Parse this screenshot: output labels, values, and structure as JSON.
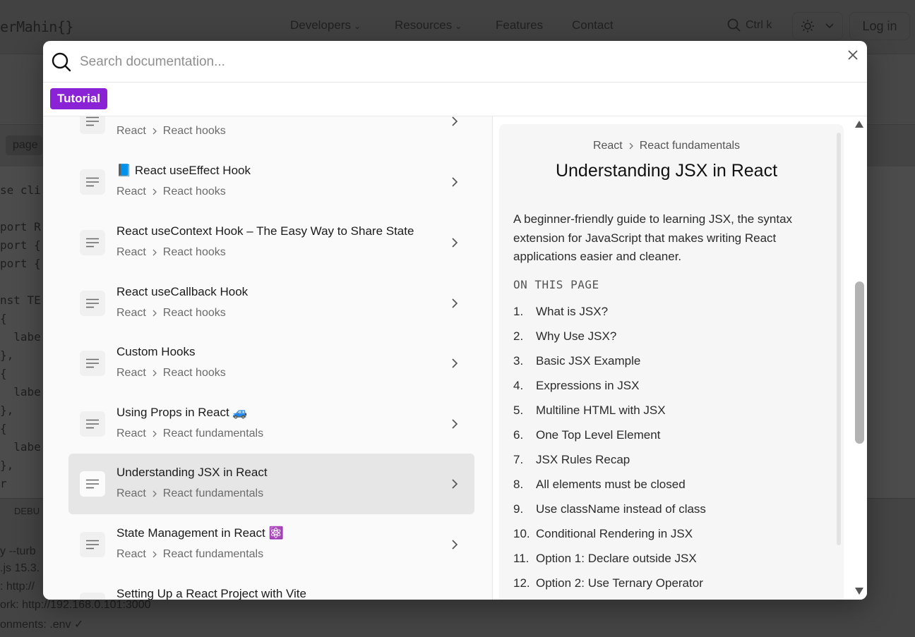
{
  "background": {
    "logo": "erMahin{}",
    "nav": [
      "Developers",
      "Resources",
      "Features",
      "Contact"
    ],
    "search_hint": "Ctrl k",
    "login": "Log in",
    "page_chip": "page",
    "code_lines": [
      "se cli",
      "port R",
      "port {",
      "port {",
      "nst TE",
      "{",
      "  labe",
      "},",
      "{",
      "  labe",
      "},",
      "{",
      "  labe",
      "},",
      "r"
    ],
    "terminal_label": "DEBU",
    "terminal_lines": [
      "y --turb",
      ".js 15.3.",
      ": http://",
      "ork: http://192.168.0.101:3000",
      "onments: .env ✓"
    ]
  },
  "search": {
    "placeholder": "Search documentation..."
  },
  "tag": "Tutorial",
  "results": [
    {
      "title": "",
      "crumbs": [
        "React",
        "React hooks"
      ]
    },
    {
      "title": "📘 React useEffect Hook",
      "crumbs": [
        "React",
        "React hooks"
      ]
    },
    {
      "title": "React useContext Hook – The Easy Way to Share State",
      "crumbs": [
        "React",
        "React hooks"
      ]
    },
    {
      "title": "React useCallback Hook",
      "crumbs": [
        "React",
        "React hooks"
      ]
    },
    {
      "title": "Custom Hooks",
      "crumbs": [
        "React",
        "React hooks"
      ]
    },
    {
      "title": "Using Props in React 🚙",
      "crumbs": [
        "React",
        "React fundamentals"
      ]
    },
    {
      "title": "Understanding JSX in React",
      "crumbs": [
        "React",
        "React fundamentals"
      ],
      "active": true
    },
    {
      "title": "State Management in React ⚛️",
      "crumbs": [
        "React",
        "React fundamentals"
      ]
    },
    {
      "title": "Setting Up a React Project with Vite",
      "crumbs": [
        "",
        ""
      ]
    }
  ],
  "preview": {
    "crumbs": [
      "React",
      "React fundamentals"
    ],
    "title": "Understanding JSX in React",
    "description": "A beginner-friendly guide to learning JSX, the syntax extension for JavaScript that makes writing React applications easier and cleaner.",
    "on_this_page": "ON THIS PAGE",
    "toc": [
      {
        "num": "1.",
        "label": "What is JSX?"
      },
      {
        "num": "2.",
        "label": "Why Use JSX?"
      },
      {
        "num": "3.",
        "label": "Basic JSX Example"
      },
      {
        "num": "4.",
        "label": "Expressions in JSX"
      },
      {
        "num": "5.",
        "label": "Multiline HTML with JSX"
      },
      {
        "num": "6.",
        "label": "One Top Level Element"
      },
      {
        "num": "7.",
        "label": "JSX Rules Recap"
      },
      {
        "num": "8.",
        "label": "All elements must be closed"
      },
      {
        "num": "9.",
        "label": "Use className instead of class"
      },
      {
        "num": "10.",
        "label": "Conditional Rendering in JSX"
      },
      {
        "num": "11.",
        "label": "Option 1: Declare outside JSX"
      },
      {
        "num": "12.",
        "label": "Option 2: Use Ternary Operator"
      }
    ]
  },
  "colors": {
    "tag": "#8a22d6",
    "active_item": "#e6e6e7",
    "overlay": "#4a4a4a"
  }
}
